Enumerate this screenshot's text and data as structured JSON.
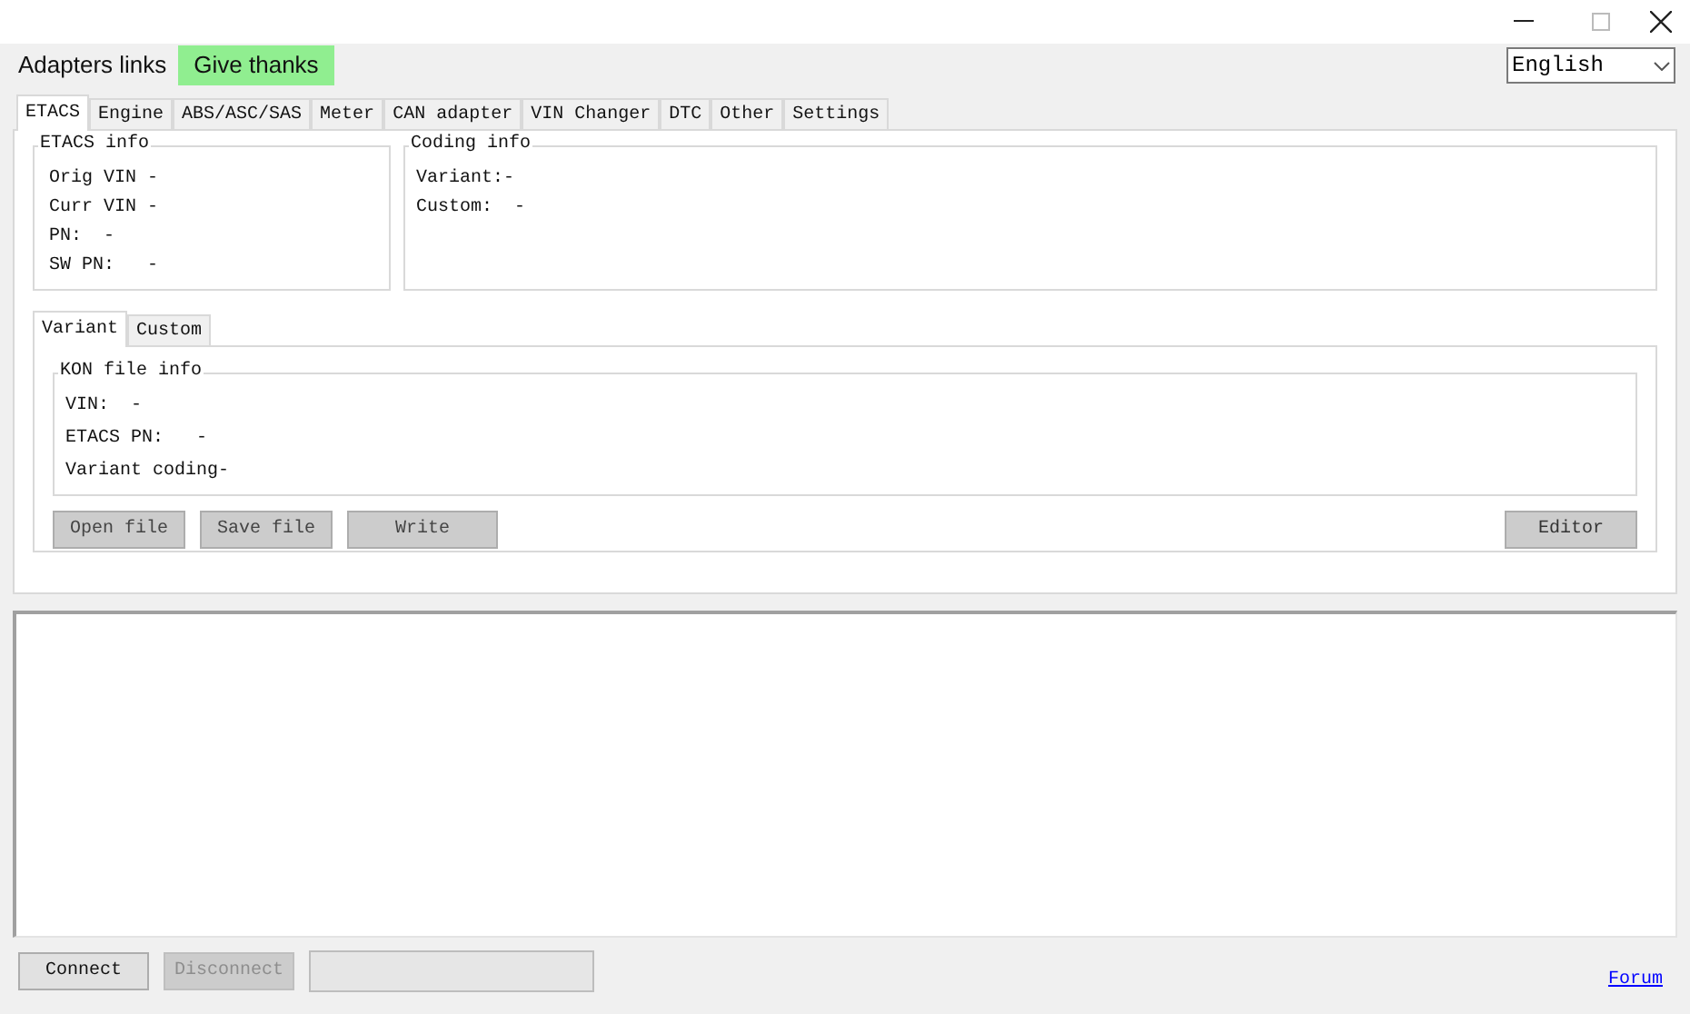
{
  "menu": [
    {
      "label": "Adapters links",
      "highlighted": false
    },
    {
      "label": "Give thanks",
      "highlighted": true
    }
  ],
  "language": {
    "value": "English"
  },
  "tabs": [
    {
      "label": "ETACS",
      "selected": true
    },
    {
      "label": "Engine",
      "selected": false
    },
    {
      "label": "ABS/ASC/SAS",
      "selected": false
    },
    {
      "label": "Meter",
      "selected": false
    },
    {
      "label": "CAN adapter",
      "selected": false
    },
    {
      "label": "VIN Changer",
      "selected": false
    },
    {
      "label": "DTC",
      "selected": false
    },
    {
      "label": "Other",
      "selected": false
    },
    {
      "label": "Settings",
      "selected": false
    }
  ],
  "etacs_info": {
    "title": "ETACS info",
    "lines": [
      "Orig VIN -",
      "Curr VIN -",
      "PN:  -",
      "SW PN:   -"
    ]
  },
  "coding_info": {
    "title": "Coding info",
    "lines": [
      "Variant:-",
      "Custom:  -"
    ]
  },
  "sub_tabs": [
    {
      "label": "Variant",
      "selected": true
    },
    {
      "label": "Custom",
      "selected": false
    }
  ],
  "kon_file_info": {
    "title": "KON file info",
    "lines": [
      "VIN:  -",
      "ETACS PN:   -",
      "Variant coding-"
    ]
  },
  "file_buttons": [
    "Open file",
    "Save file",
    "Write"
  ],
  "editor_button": "Editor",
  "bottom_buttons": [
    {
      "label": "Connect",
      "disabled": false
    },
    {
      "label": "Disconnect",
      "disabled": true
    }
  ],
  "forum_link": "Forum"
}
